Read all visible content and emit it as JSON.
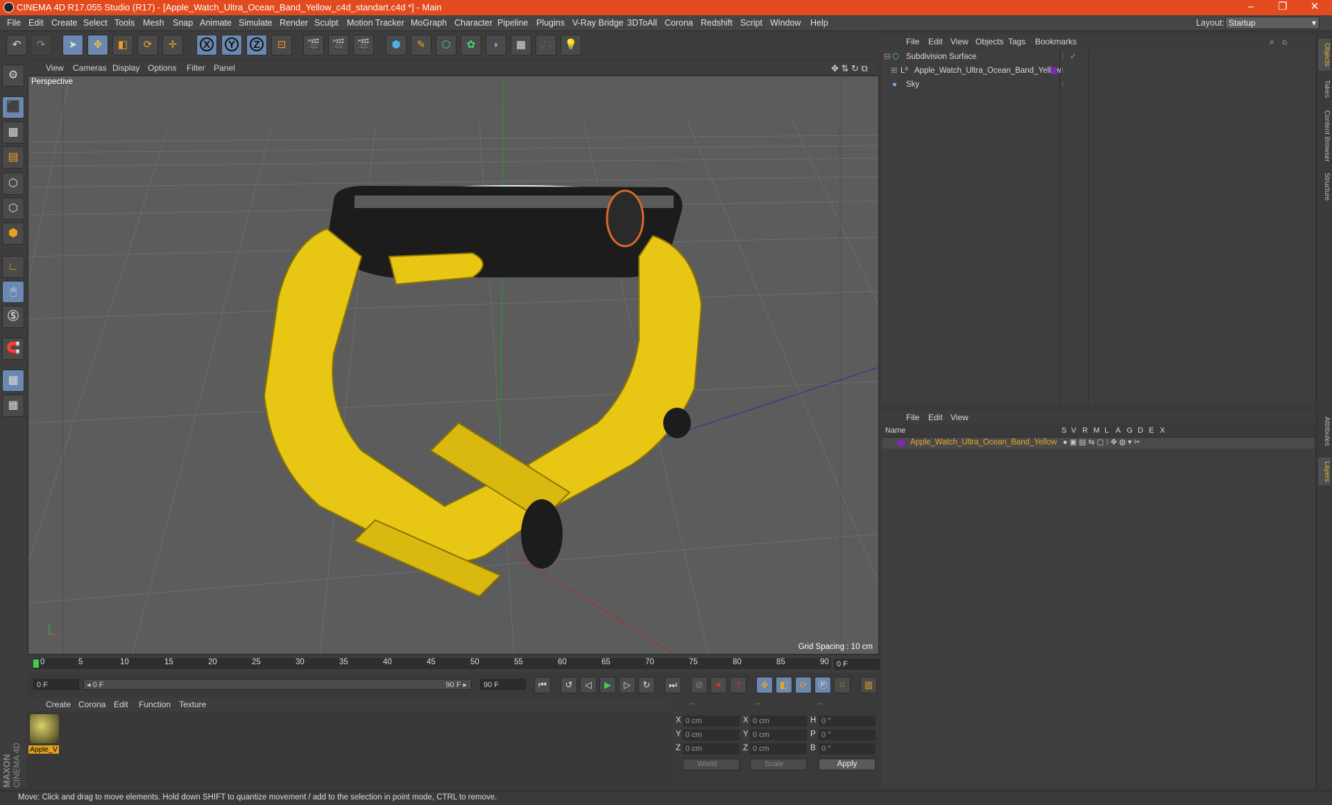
{
  "window": {
    "title": "CINEMA 4D R17.055 Studio (R17) - [Apple_Watch_Ultra_Ocean_Band_Yellow_c4d_standart.c4d *] - Main",
    "minimize": "–",
    "restore": "❐",
    "close": "✕"
  },
  "menubar": {
    "items": [
      "File",
      "Edit",
      "Create",
      "Select",
      "Tools",
      "Mesh",
      "Snap",
      "Animate",
      "Simulate",
      "Render",
      "Sculpt",
      "Motion Tracker",
      "MoGraph",
      "Character",
      "Pipeline",
      "Plugins",
      "V-Ray Bridge",
      "3DToAll",
      "Corona",
      "Redshift",
      "Script",
      "Window",
      "Help"
    ],
    "layout_label": "Layout:",
    "layout_value": "Startup"
  },
  "viewport": {
    "menu": [
      "View",
      "Cameras",
      "Display",
      "Options",
      "Filter",
      "Panel"
    ],
    "camera_label": "Perspective",
    "grid_spacing": "Grid Spacing : 10 cm"
  },
  "timeline": {
    "ticks": [
      "0",
      "5",
      "10",
      "15",
      "20",
      "25",
      "30",
      "35",
      "40",
      "45",
      "50",
      "55",
      "60",
      "65",
      "70",
      "75",
      "80",
      "85",
      "90"
    ],
    "current_frame": "0 F",
    "start_field": "0 F",
    "range_start": "◂ 0 F",
    "range_end": "90 F ▸",
    "end_field": "90 F"
  },
  "material_manager": {
    "menu": [
      "Create",
      "Corona",
      "Edit",
      "Function",
      "Texture"
    ],
    "material_name": "Apple_V"
  },
  "coordinates": {
    "headers": [
      "--",
      "--",
      "--"
    ],
    "rows": [
      {
        "a": "X",
        "av": "0 cm",
        "b": "X",
        "bv": "0 cm",
        "c": "H",
        "cv": "0 °"
      },
      {
        "a": "Y",
        "av": "0 cm",
        "b": "Y",
        "bv": "0 cm",
        "c": "P",
        "cv": "0 °"
      },
      {
        "a": "Z",
        "av": "0 cm",
        "b": "Z",
        "bv": "0 cm",
        "c": "B",
        "cv": "0 °"
      }
    ],
    "world": "World",
    "scale": "Scale",
    "apply": "Apply"
  },
  "object_manager": {
    "menu": [
      "File",
      "Edit",
      "View",
      "Objects",
      "Tags",
      "Bookmarks"
    ],
    "objects": [
      {
        "name": "Subdivision Surface",
        "color": "#cfcfcf"
      },
      {
        "name": "Apple_Watch_Ultra_Ocean_Band_Yellow",
        "color": "#cfcfcf"
      },
      {
        "name": "Sky",
        "color": "#cfcfcf"
      }
    ]
  },
  "layer_manager": {
    "menu": [
      "File",
      "Edit",
      "View"
    ],
    "columns": [
      "Name",
      "S",
      "V",
      "R",
      "M",
      "L",
      "A",
      "G",
      "D",
      "E",
      "X"
    ],
    "layer_name": "Apple_Watch_Ultra_Ocean_Band_Yellow",
    "layer_color": "#e9a62a"
  },
  "right_tabs": [
    "Objects",
    "Takes",
    "Content Browser",
    "Structure",
    "Attributes",
    "Layers"
  ],
  "status": "Move: Click and drag to move elements. Hold down SHIFT to quantize movement / add to the selection in point mode, CTRL to remove.",
  "branding": {
    "line1": "MAXON",
    "line2": "CINEMA 4D"
  },
  "colors": {
    "title_bar": "#e34b1f",
    "band": "#e8c614",
    "accent": "#6a88b0"
  }
}
